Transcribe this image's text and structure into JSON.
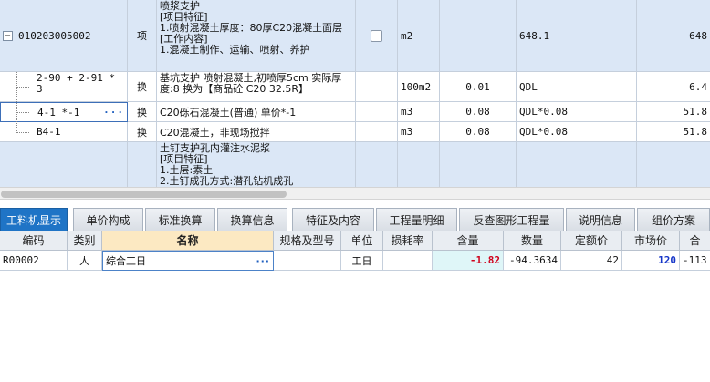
{
  "upper_grid": {
    "rows": [
      {
        "code": "010203005002",
        "type": "项",
        "name_lines": [
          "喷浆支护",
          "[项目特征]",
          "1.喷射混凝土厚度：80厚C20混凝土面层",
          "[工作内容]",
          "1.混凝土制作、运输、喷射、养护"
        ],
        "unit": "m2",
        "quantity_expr": "",
        "quantity": "648.1",
        "price_code": "",
        "right_value": "648"
      },
      {
        "code": "2-90 + 2-91 * 3",
        "type": "换",
        "name_lines": [
          "基坑支护 喷射混凝土,初喷厚5cm  实际厚度:8  换为【商品砼 C20 32.5R】"
        ],
        "unit": "100m2",
        "quantity_expr": "0.01",
        "quantity": "QDL",
        "price_code": "",
        "right_value": "6.4"
      },
      {
        "code": "4-1 *-1",
        "code_dots": "···",
        "type": "换",
        "name_lines": [
          "C20砾石混凝土(普通)  单价*-1"
        ],
        "unit": "m3",
        "quantity_expr": "0.08",
        "quantity": "QDL*0.08",
        "price_code": "",
        "right_value": "51.8"
      },
      {
        "code": "B4-1",
        "type": "换",
        "name_lines": [
          "C20混凝土，非现场搅拌"
        ],
        "unit": "m3",
        "quantity_expr": "0.08",
        "quantity": "QDL*0.08",
        "price_code": "",
        "right_value": "51.8"
      },
      {
        "code": "",
        "type": "",
        "name_lines": [
          "土钉支护孔内灌注水泥浆",
          "[项目特征]",
          "1.土层:素土",
          "2.土钉成孔方式:潜孔钻机成孔"
        ],
        "unit": "",
        "quantity_expr": "",
        "quantity": "",
        "price_code": "",
        "right_value": ""
      }
    ]
  },
  "tabs": [
    {
      "label": "工料机显示",
      "active": true
    },
    {
      "label": "单价构成",
      "active": false
    },
    {
      "label": "标准换算",
      "active": false
    },
    {
      "label": "换算信息",
      "active": false
    },
    {
      "label": "特征及内容",
      "active": false
    },
    {
      "label": "工程量明细",
      "active": false
    },
    {
      "label": "反查图形工程量",
      "active": false
    },
    {
      "label": "说明信息",
      "active": false
    },
    {
      "label": "组价方案",
      "active": false
    }
  ],
  "lower_grid": {
    "headers": [
      "编码",
      "类别",
      "名称",
      "规格及型号",
      "单位",
      "损耗率",
      "含量",
      "数量",
      "定额价",
      "市场价",
      "合"
    ],
    "row": {
      "code": "R00002",
      "category": "人",
      "name": "综合工日",
      "name_dots": "···",
      "spec": "",
      "unit": "工日",
      "loss_rate": "",
      "content": "-1.82",
      "amount": "-94.3634",
      "quota_price": "42",
      "market_price": "120",
      "total": "-113"
    }
  },
  "colors": {
    "row_blue": "#dbe7f6",
    "active_tab": "#1f74c6",
    "negative": "#d0021b",
    "market_price": "#1434c8"
  }
}
